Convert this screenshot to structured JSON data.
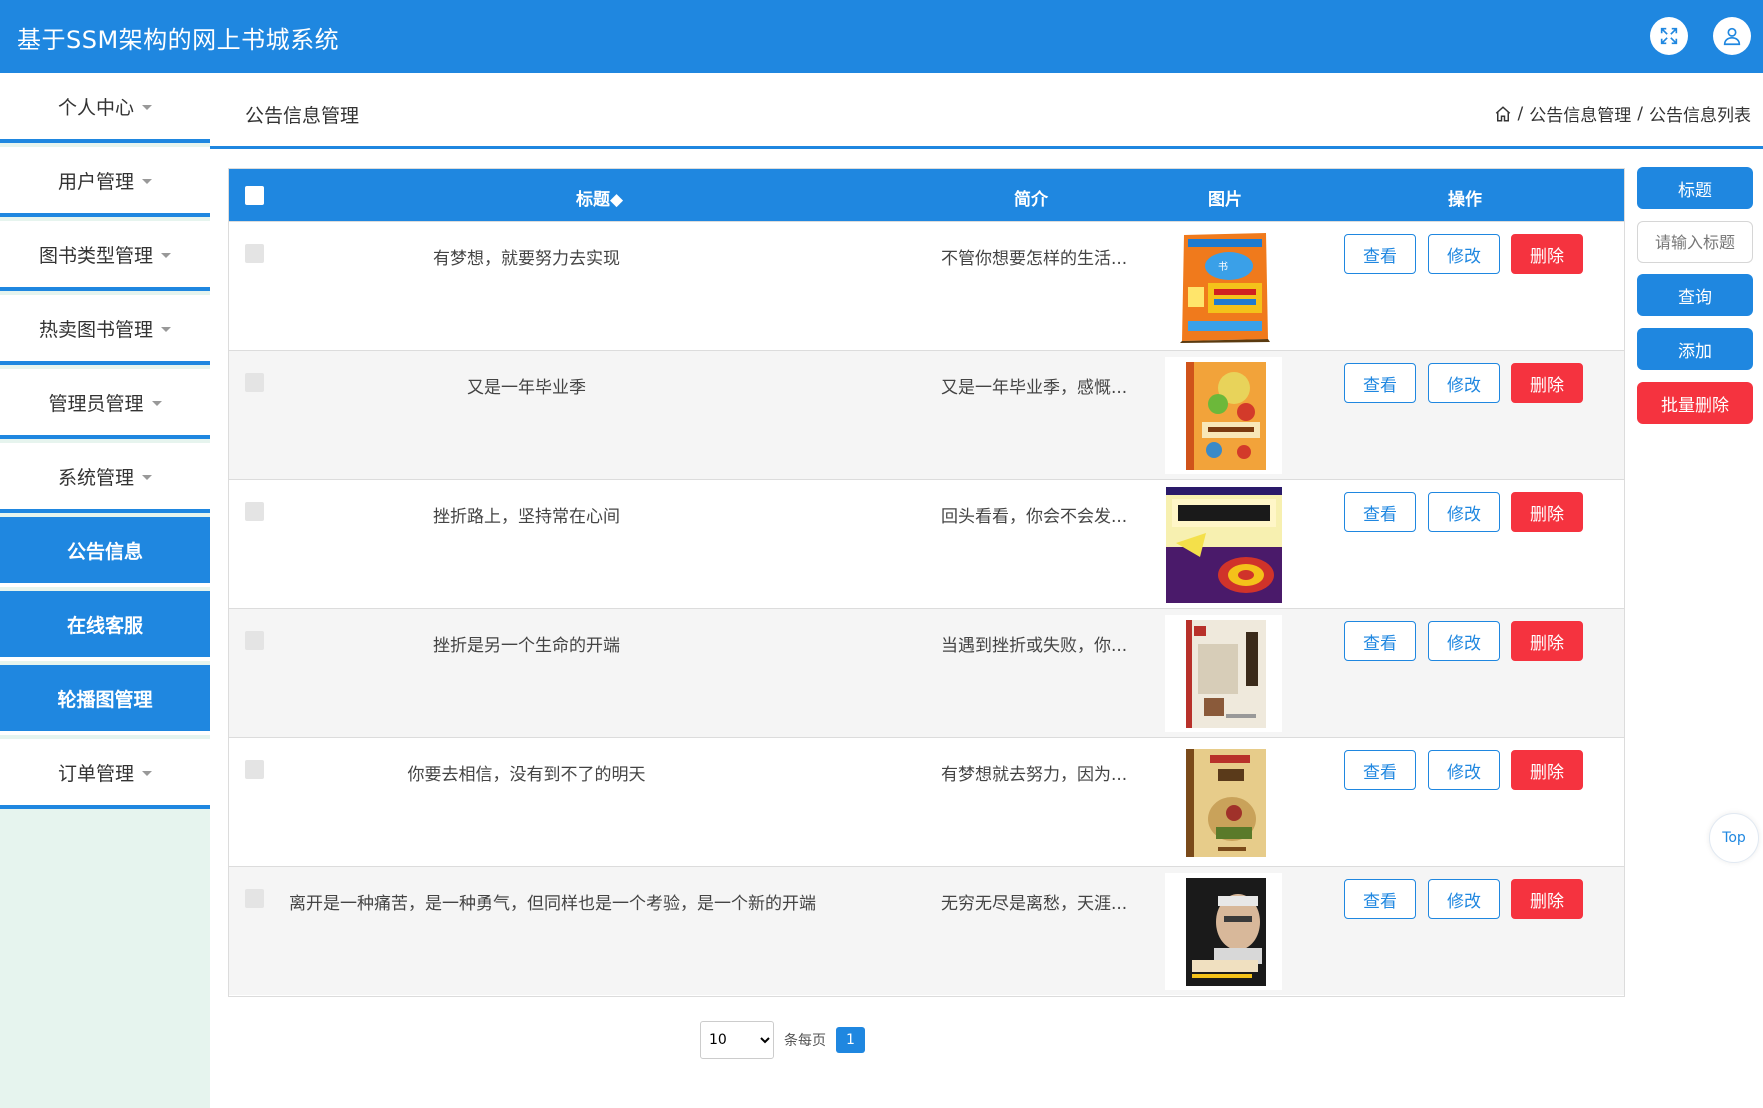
{
  "app": {
    "title": "基于SSM架构的网上书城系统"
  },
  "header_icons": [
    {
      "name": "fullscreen-icon"
    },
    {
      "name": "user-icon"
    }
  ],
  "sidebar": {
    "items": [
      {
        "label": "个人中心",
        "active": false,
        "dropdown": true
      },
      {
        "label": "用户管理",
        "active": false,
        "dropdown": true
      },
      {
        "label": "图书类型管理",
        "active": false,
        "dropdown": true
      },
      {
        "label": "热卖图书管理",
        "active": false,
        "dropdown": true
      },
      {
        "label": "管理员管理",
        "active": false,
        "dropdown": true
      },
      {
        "label": "系统管理",
        "active": false,
        "dropdown": true
      },
      {
        "label": "公告信息",
        "active": true,
        "dropdown": false
      },
      {
        "label": "在线客服",
        "active": true,
        "dropdown": false
      },
      {
        "label": "轮播图管理",
        "active": true,
        "dropdown": false
      },
      {
        "label": "订单管理",
        "active": false,
        "dropdown": true
      }
    ]
  },
  "page": {
    "title": "公告信息管理",
    "breadcrumb": [
      "公告信息管理",
      "公告信息列表"
    ],
    "breadcrumb_sep": "/"
  },
  "table": {
    "columns": {
      "title": "标题◆",
      "intro": "简介",
      "image": "图片",
      "actions": "操作"
    },
    "actions": {
      "view": "查看",
      "edit": "修改",
      "delete": "删除"
    },
    "rows": [
      {
        "title": "有梦想，就要努力去实现",
        "intro": "不管你想要怎样的生活...",
        "cover": "textbook-cover"
      },
      {
        "title": "又是一年毕业季",
        "intro": "又是一年毕业季，感慨...",
        "cover": "history-cover"
      },
      {
        "title": "挫折路上，坚持常在心间",
        "intro": "回头看看，你会不会发...",
        "cover": "gymnastics-cover"
      },
      {
        "title": "挫折是另一个生命的开端",
        "intro": "当遇到挫折或失败，你...",
        "cover": "classic-cover"
      },
      {
        "title": "你要去相信，没有到不了的明天",
        "intro": "有梦想就去努力，因为...",
        "cover": "zhuangzi-cover"
      },
      {
        "title": "离开是一种痛苦，是一种勇气，但同样也是一个考验，是一个新的开端",
        "intro": "无穷无尽是离愁，天涯...",
        "cover": "portrait-cover"
      }
    ]
  },
  "search_panel": {
    "field_label": "标题",
    "placeholder": "请输入标题",
    "query": "查询",
    "add": "添加",
    "batch_delete": "批量删除"
  },
  "back_to_top": "Top",
  "pagination": {
    "page_size": "10",
    "per_page_label": "条每页",
    "current_page": "1"
  },
  "colors": {
    "primary": "#1f87e0",
    "danger": "#f5333f",
    "sidebar_bg": "#e6f4ee"
  }
}
